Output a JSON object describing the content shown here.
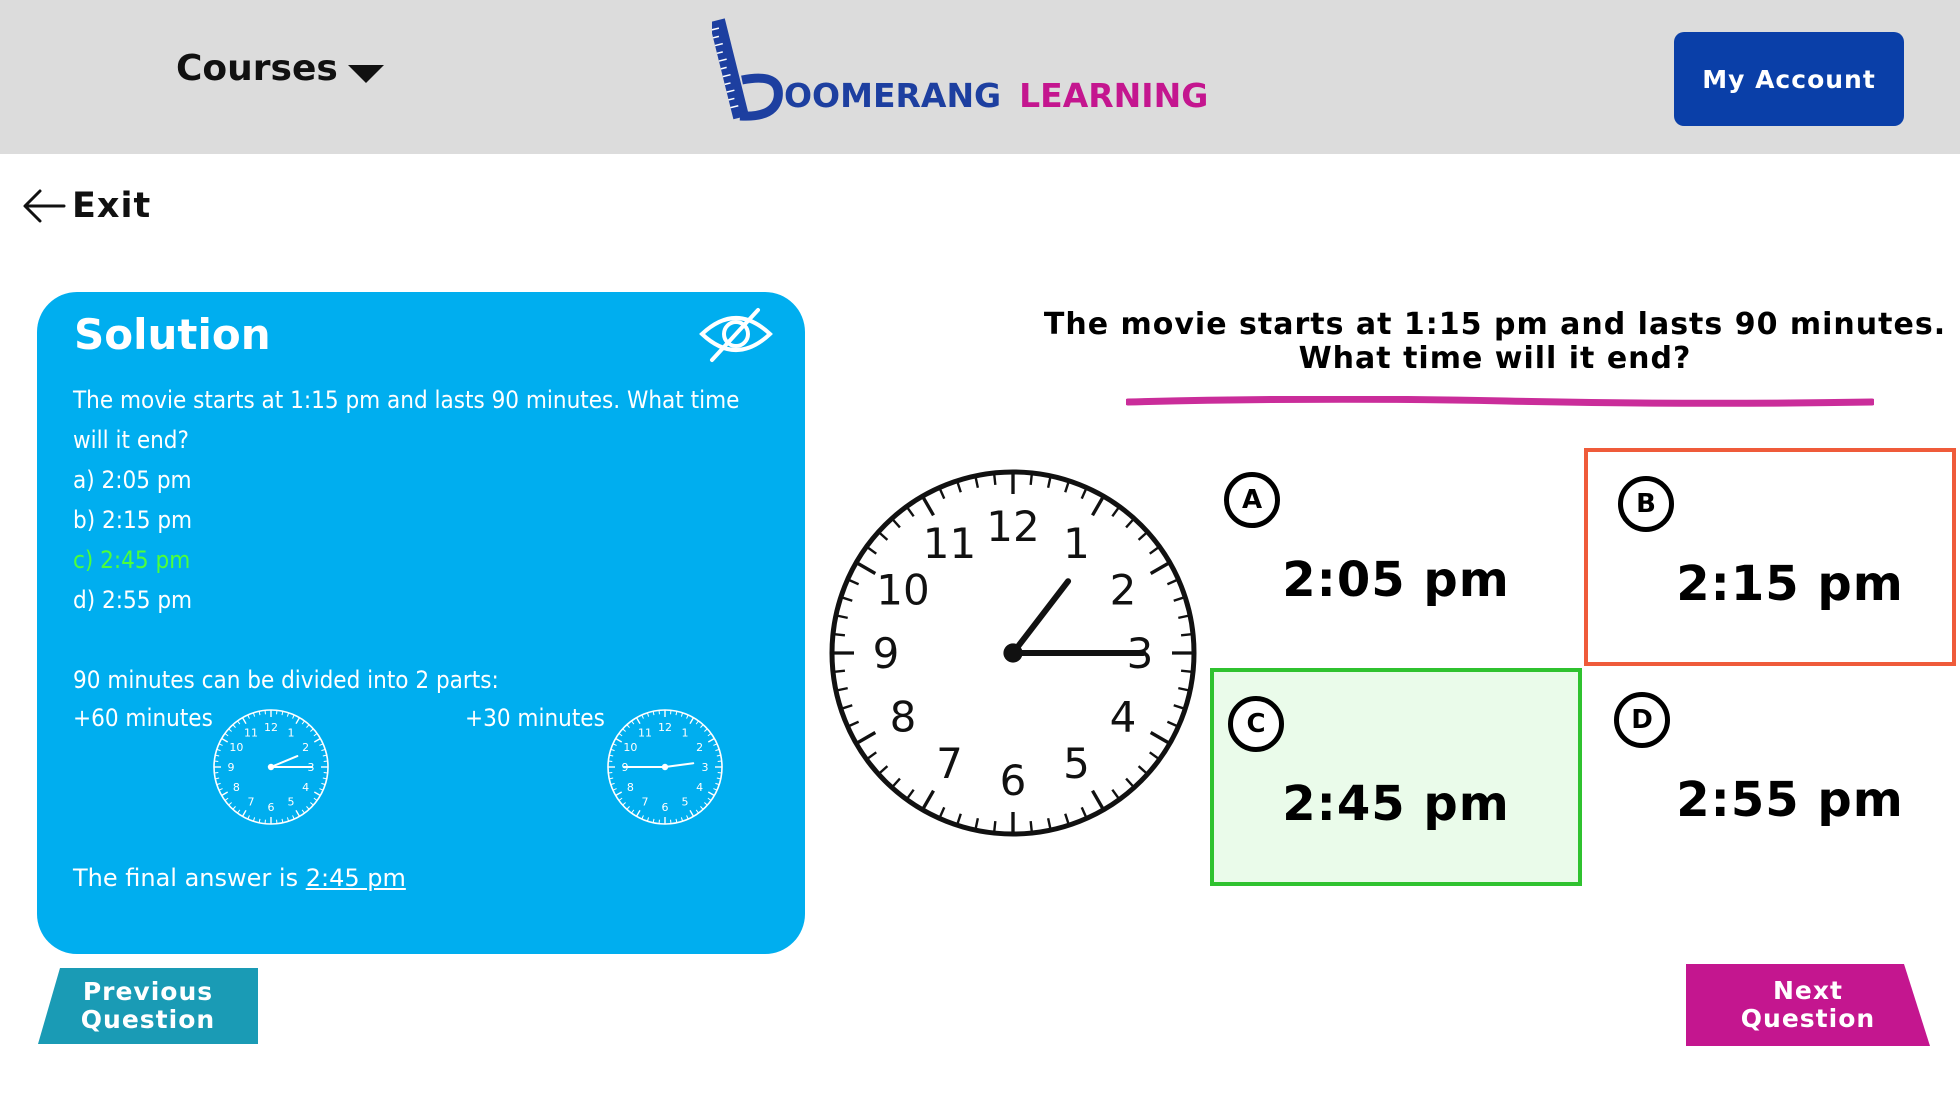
{
  "header": {
    "courses_label": "Courses",
    "logo_word1": "OOMERANG",
    "logo_word2": "LEARNING",
    "account_label": "My Account"
  },
  "nav": {
    "exit_label": "Exit"
  },
  "solution": {
    "title": "Solution",
    "question_lines": [
      "The movie starts at 1:15 pm and lasts 90 minutes. What time",
      "will it end?"
    ],
    "options": [
      "a) 2:05 pm",
      "b) 2:15 pm",
      "c) 2:45 pm",
      "d) 2:55 pm"
    ],
    "divide_text": "90 minutes can be divided into 2 parts:",
    "part1_label": "+60 minutes",
    "part2_label": "+30 minutes",
    "final_prefix": "The final answer is ",
    "final_answer": "2:45 pm",
    "correct_color": "#4dff3a",
    "panel_color": "#00aeef"
  },
  "question": {
    "line1": "The movie starts at 1:15 pm and lasts 90 minutes.",
    "line2": "What time will it end?"
  },
  "answers": [
    {
      "letter": "A",
      "text": "2:05 pm",
      "state": "none"
    },
    {
      "letter": "B",
      "text": "2:15 pm",
      "state": "incorrect"
    },
    {
      "letter": "C",
      "text": "2:45 pm",
      "state": "correct"
    },
    {
      "letter": "D",
      "text": "2:55 pm",
      "state": "none"
    }
  ],
  "buttons": {
    "previous_line1": "Previous",
    "previous_line2": "Question",
    "next_line1": "Next",
    "next_line2": "Question"
  },
  "colors": {
    "header_bg": "#dcdcdc",
    "account_bg": "#0a3fa8",
    "brand_blue": "#1d3fa0",
    "brand_pink": "#c4168f",
    "incorrect_border": "#ef5b3a",
    "correct_border": "#2fc22f",
    "prev_button": "#1a9bb5",
    "next_button": "#c4168f"
  },
  "icons": {
    "exit": "arrow-left-icon",
    "hide": "eye-slash-icon",
    "courses": "caret-down-icon"
  }
}
